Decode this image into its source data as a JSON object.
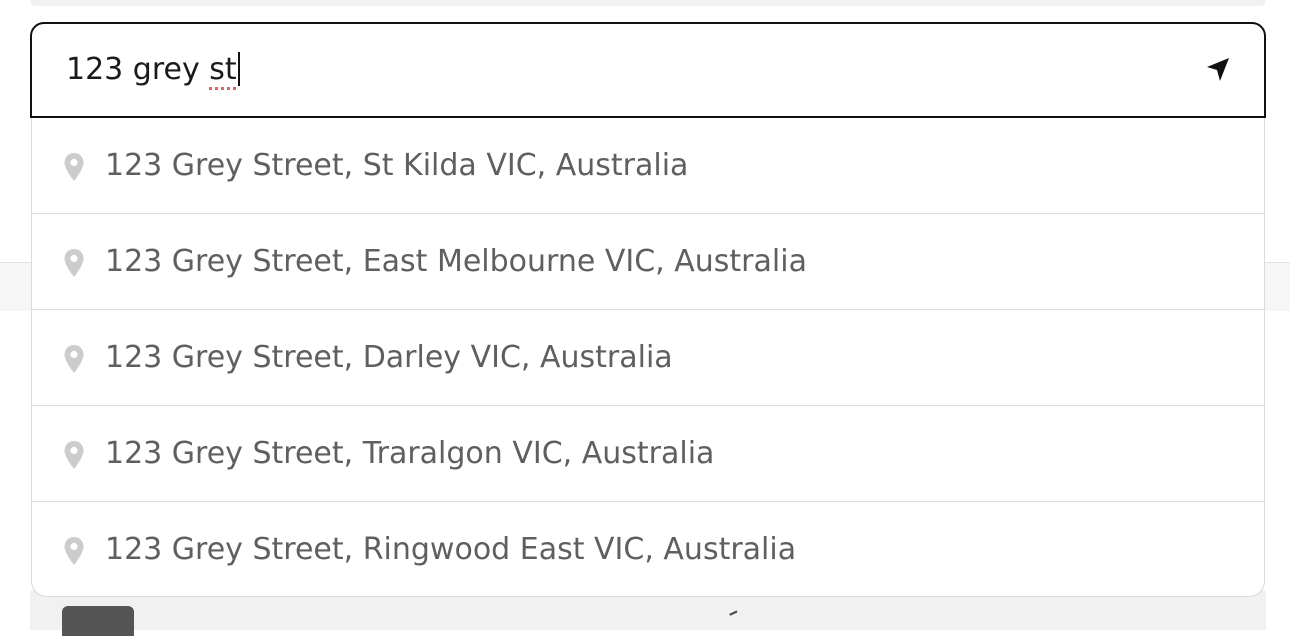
{
  "search": {
    "value_main": "123 grey ",
    "value_tail": "st",
    "locate_icon": "navigation-arrow-icon"
  },
  "suggestions": [
    {
      "label": "123 Grey Street, St Kilda VIC, Australia",
      "icon": "location-pin-icon"
    },
    {
      "label": "123 Grey Street, East Melbourne VIC, Australia",
      "icon": "location-pin-icon"
    },
    {
      "label": "123 Grey Street, Darley VIC, Australia",
      "icon": "location-pin-icon"
    },
    {
      "label": "123 Grey Street, Traralgon VIC, Australia",
      "icon": "location-pin-icon"
    },
    {
      "label": "123 Grey Street, Ringwood East VIC, Australia",
      "icon": "location-pin-icon"
    }
  ],
  "colors": {
    "border_focus": "#111111",
    "suggestion_text": "#5f5f5f",
    "pin": "#cccccc",
    "spellcheck": "#e06666"
  }
}
